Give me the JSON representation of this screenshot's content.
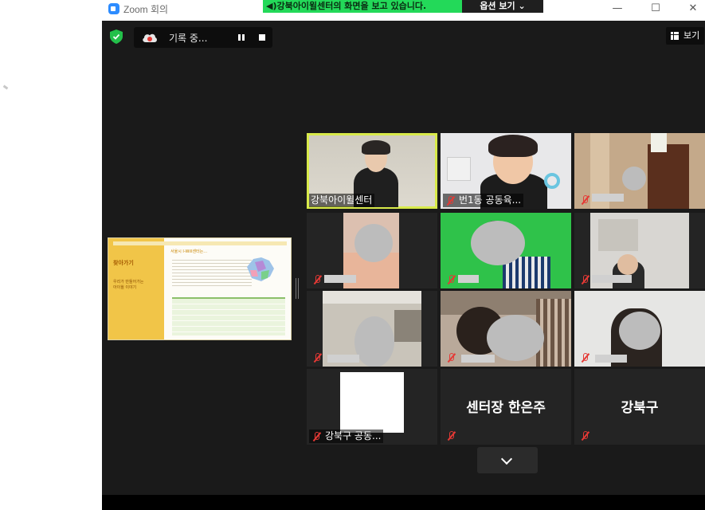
{
  "window": {
    "title": "Zoom 회의",
    "share_banner": "강북아이윌센터의 화면을 보고 있습니다.",
    "options_label": "옵션 보기",
    "controls": {
      "minimize": "—",
      "maximize": "☐",
      "close": "✕"
    }
  },
  "toolbar": {
    "recording_label": "기록 중...",
    "view_label": "보기"
  },
  "shared_screen": {
    "heading": "찾아가기",
    "subtitle": "우리가 만들어가는\n아이윌 이야기",
    "section_title": "서울시 I-Will센터는..."
  },
  "participants": [
    {
      "name": "강북아이윌센터",
      "active": true,
      "muted": false
    },
    {
      "name": "번1동 공동육...",
      "active": false,
      "muted": true
    },
    {
      "name": "",
      "active": false,
      "muted": true
    },
    {
      "name": "",
      "active": false,
      "muted": true
    },
    {
      "name": "",
      "active": false,
      "muted": true
    },
    {
      "name": "",
      "active": false,
      "muted": true
    },
    {
      "name": "",
      "active": false,
      "muted": true
    },
    {
      "name": "",
      "active": false,
      "muted": true
    },
    {
      "name": "",
      "active": false,
      "muted": true
    },
    {
      "name": "강북구 공동...",
      "active": false,
      "muted": true
    },
    {
      "name": "센터장 한은주",
      "active": false,
      "muted": true,
      "video_off": true
    },
    {
      "name": "강북구",
      "active": false,
      "muted": true,
      "video_off": true
    }
  ],
  "colors": {
    "active_speaker": "#d8ea4a",
    "share_banner": "#23d959",
    "muted": "#e53935",
    "secure": "#23c04a"
  }
}
